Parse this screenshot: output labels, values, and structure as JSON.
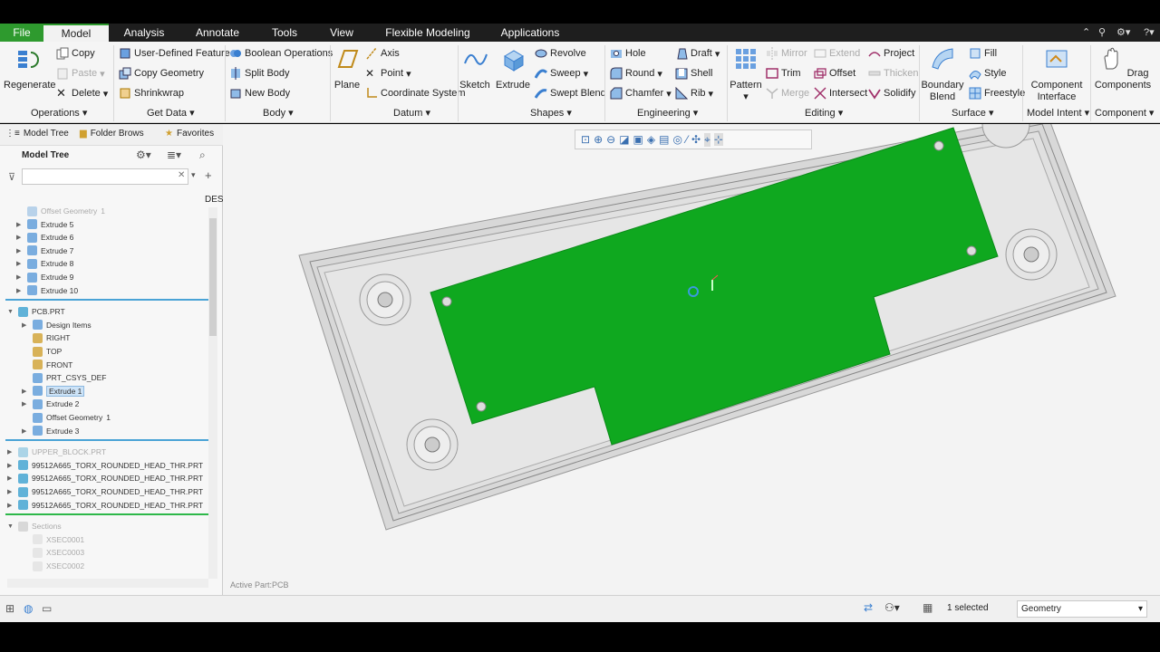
{
  "menu": {
    "file": "File",
    "tabs": [
      "Model",
      "Analysis",
      "Annotate",
      "Tools",
      "View",
      "Flexible Modeling",
      "Applications"
    ],
    "active": "Model"
  },
  "ribbon": {
    "regenerate": "Regenerate",
    "copy": "Copy",
    "paste": "Paste",
    "delete": "Delete",
    "user_defined_feature": "User-Defined Feature",
    "copy_geometry": "Copy Geometry",
    "shrinkwrap": "Shrinkwrap",
    "boolean_operations": "Boolean Operations",
    "split_body": "Split Body",
    "new_body": "New Body",
    "plane": "Plane",
    "axis": "Axis",
    "point": "Point",
    "coordinate_system": "Coordinate System",
    "sketch": "Sketch",
    "extrude": "Extrude",
    "revolve": "Revolve",
    "sweep": "Sweep",
    "swept_blend": "Swept Blend",
    "hole": "Hole",
    "round": "Round",
    "chamfer": "Chamfer",
    "draft": "Draft",
    "shell": "Shell",
    "rib": "Rib",
    "pattern": "Pattern",
    "mirror": "Mirror",
    "trim": "Trim",
    "merge": "Merge",
    "extend": "Extend",
    "offset": "Offset",
    "intersect": "Intersect",
    "project": "Project",
    "thicken": "Thicken",
    "solidify": "Solidify",
    "boundary_blend_1": "Boundary",
    "boundary_blend_2": "Blend",
    "fill": "Fill",
    "style": "Style",
    "freestyle": "Freestyle",
    "component_interface_1": "Component",
    "component_interface_2": "Interface",
    "drag_components_1": "Drag",
    "drag_components_2": "Components",
    "groups": {
      "operations": "Operations",
      "get_data": "Get Data",
      "body": "Body",
      "datum": "Datum",
      "shapes": "Shapes",
      "engineering": "Engineering",
      "editing": "Editing",
      "surface": "Surface",
      "model_intent": "Model Intent",
      "component": "Component"
    }
  },
  "left_panel": {
    "tabs": [
      "Model Tree",
      "Folder Brows",
      "Favorites"
    ],
    "title": "Model Tree",
    "search_placeholder": "",
    "col_header": "DES",
    "items": [
      {
        "label": "Offset Geometry",
        "suffix": "1",
        "faded": true
      },
      {
        "label": "Extrude 5"
      },
      {
        "label": "Extrude 6"
      },
      {
        "label": "Extrude 7"
      },
      {
        "label": "Extrude 8"
      },
      {
        "label": "Extrude 9"
      },
      {
        "label": "Extrude 10"
      }
    ],
    "pcb": {
      "label": "PCB.PRT",
      "children": [
        {
          "label": "Design Items"
        },
        {
          "label": "RIGHT"
        },
        {
          "label": "TOP"
        },
        {
          "label": "FRONT"
        },
        {
          "label": "PRT_CSYS_DEF"
        },
        {
          "label": "Extrude 1",
          "selected": true
        },
        {
          "label": "Extrude 2"
        },
        {
          "label": "Offset Geometry",
          "suffix": "1"
        },
        {
          "label": "Extrude 3"
        }
      ]
    },
    "parts": [
      {
        "label": "UPPER_BLOCK.PRT",
        "faded": true
      },
      {
        "label": "99512A665_TORX_ROUNDED_HEAD_THR.PRT"
      },
      {
        "label": "99512A665_TORX_ROUNDED_HEAD_THR.PRT"
      },
      {
        "label": "99512A665_TORX_ROUNDED_HEAD_THR.PRT"
      },
      {
        "label": "99512A665_TORX_ROUNDED_HEAD_THR.PRT"
      }
    ],
    "sections": {
      "label": "Sections",
      "items": [
        "XSEC0001",
        "XSEC0003",
        "XSEC0002"
      ]
    }
  },
  "viewport": {
    "active_part": "Active Part:PCB",
    "board_color": "#0fa81f"
  },
  "status": {
    "selected": "1 selected",
    "filter": "Geometry"
  }
}
